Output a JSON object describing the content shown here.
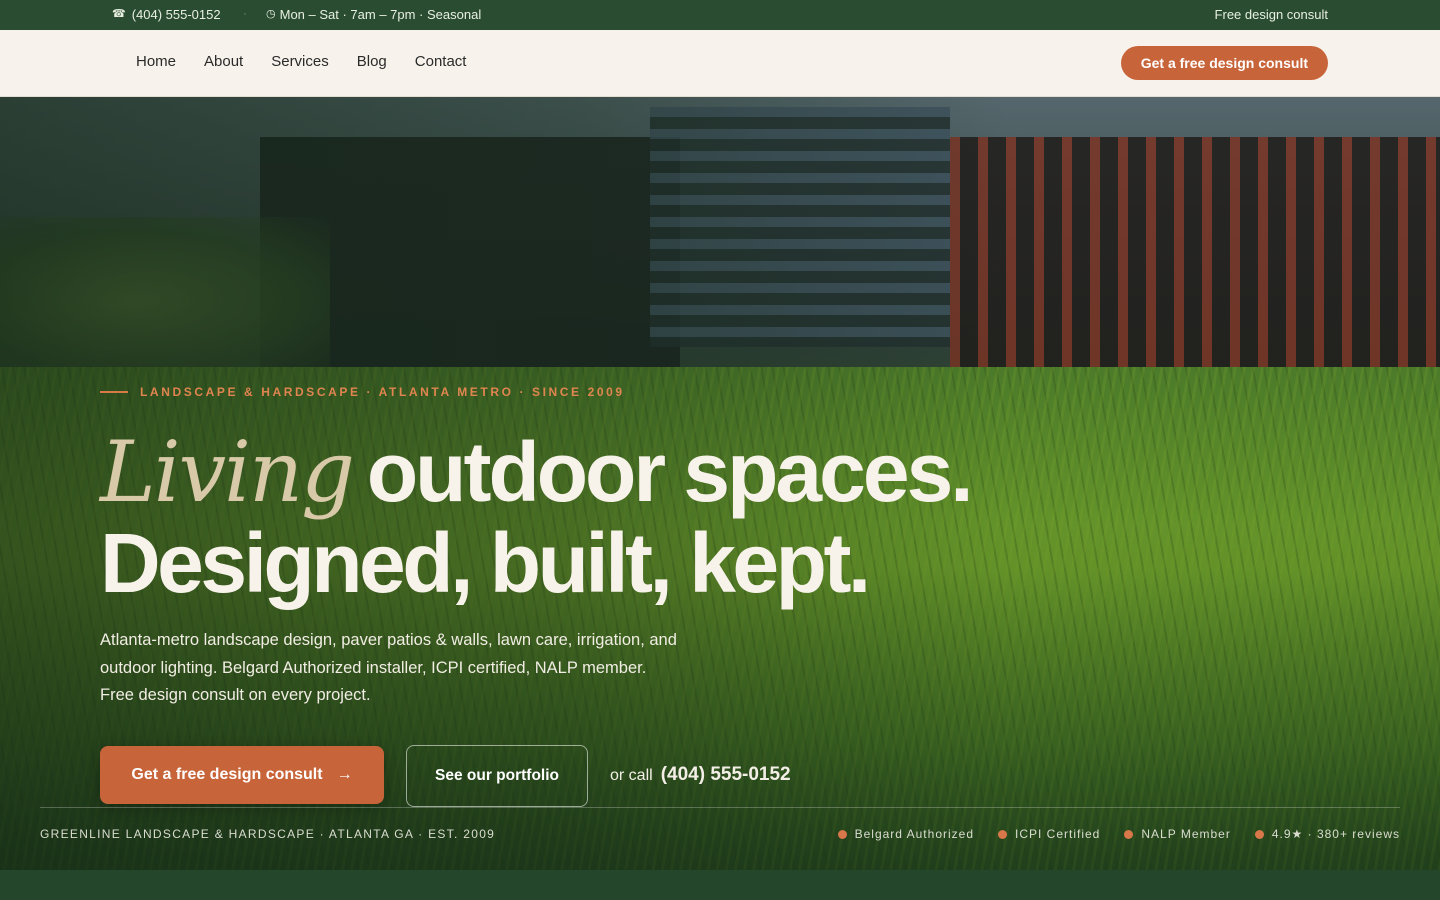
{
  "topbar": {
    "phone": "(404) 555-0152",
    "separator": "·",
    "hours": "Mon – Sat · 7am – 7pm · Seasonal",
    "right_link": "Free design consult",
    "phone_icon": "phone-icon",
    "clock_icon": "clock-icon"
  },
  "nav": {
    "links": [
      "Home",
      "About",
      "Services",
      "Blog",
      "Contact"
    ],
    "cta": "Get a free design consult"
  },
  "hero": {
    "eyebrow": "LANDSCAPE & HARDSCAPE · ATLANTA METRO · SINCE 2009",
    "headline_italic": "Living",
    "headline_rest": "outdoor spaces.",
    "headline_line2": "Designed, built, kept.",
    "lede": "Atlanta-metro landscape design, paver patios & walls, lawn care, irrigation, and outdoor lighting. Belgard Authorized installer, ICPI certified, NALP member. Free design consult on every project.",
    "cta_primary": "Get a free design consult",
    "cta_primary_arrow": "→",
    "cta_secondary": "See our portfolio",
    "or_call_label": "or call",
    "or_call_number": "(404) 555-0152"
  },
  "strip": {
    "brandline": "GREENLINE LANDSCAPE & HARDSCAPE · ATLANTA GA · EST. 2009",
    "badges": [
      "Belgard Authorized",
      "ICPI Certified",
      "NALP Member",
      "4.9★ · 380+ reviews"
    ]
  },
  "colors": {
    "accent": "#c8643a",
    "forest": "#2a4d31",
    "cream": "#f7f3ec"
  }
}
